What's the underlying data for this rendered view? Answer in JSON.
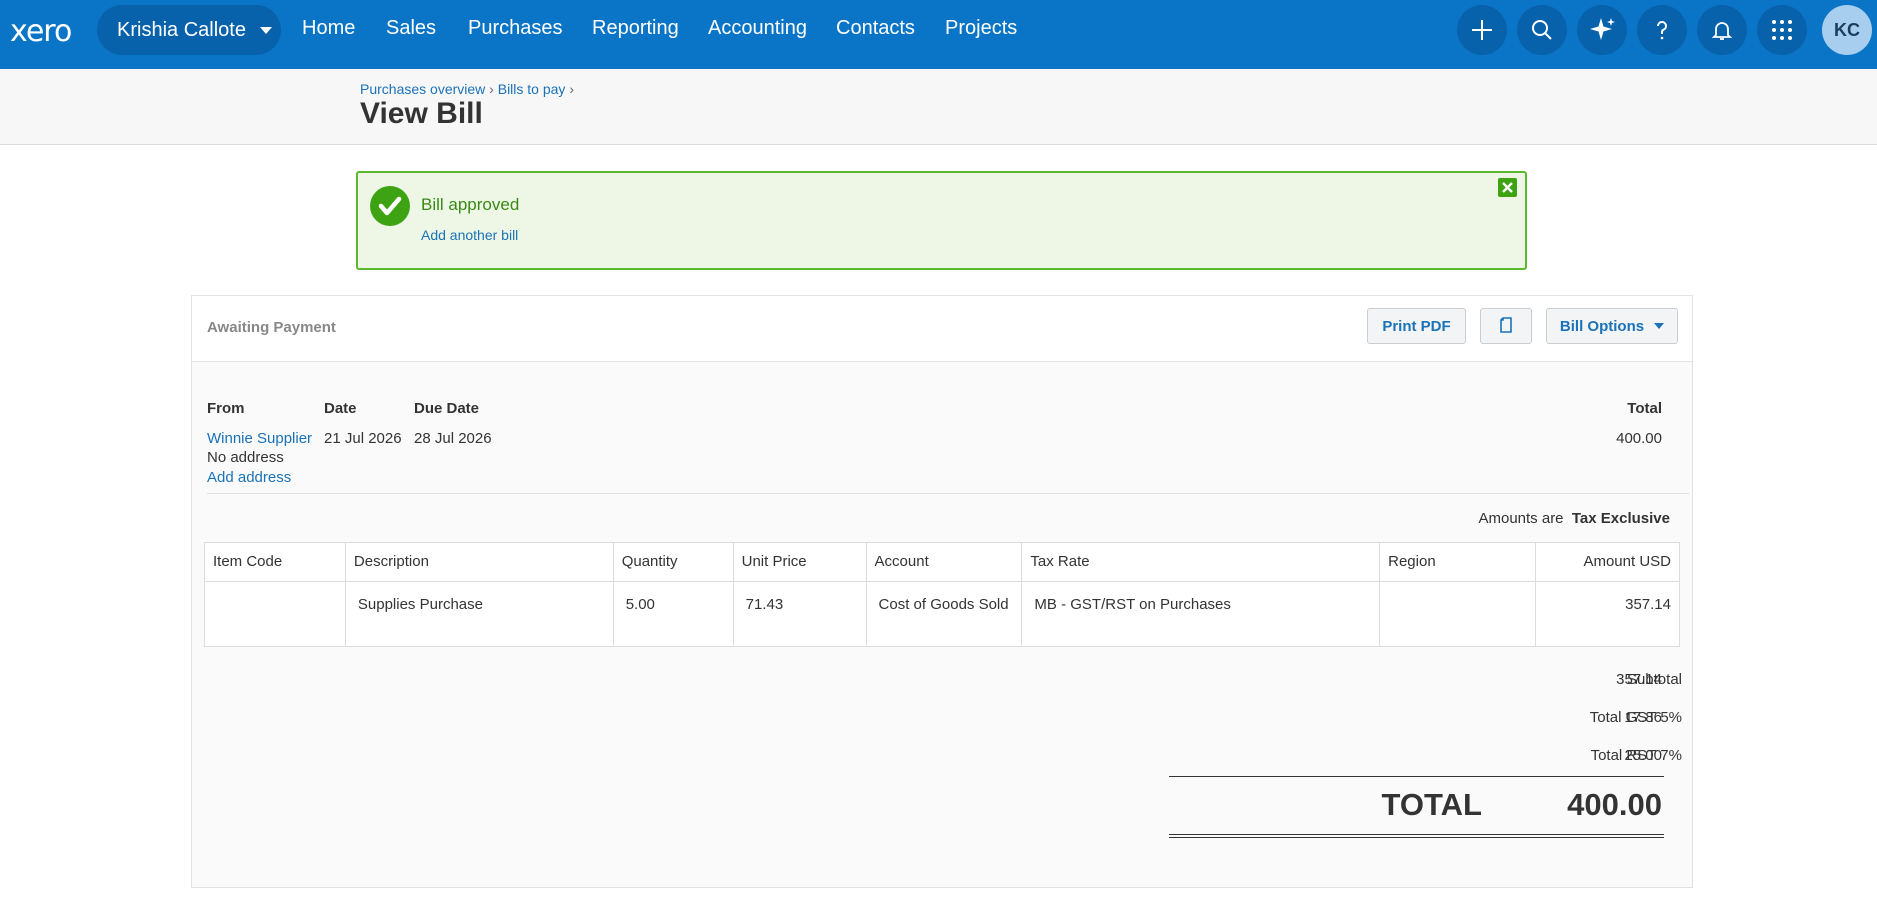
{
  "topnav": {
    "logo": "xero",
    "org_name": "Krishia Callote",
    "items": [
      "Home",
      "Sales",
      "Purchases",
      "Reporting",
      "Accounting",
      "Contacts",
      "Projects"
    ],
    "avatar_initials": "KC"
  },
  "header": {
    "breadcrumbs": [
      "Purchases overview",
      "Bills to pay"
    ],
    "separator": "›",
    "title": "View Bill"
  },
  "banner": {
    "message": "Bill approved",
    "link": "Add another bill"
  },
  "bill": {
    "status": "Awaiting Payment",
    "print_pdf": "Print PDF",
    "options_label": "Bill Options",
    "from_label": "From",
    "date_label": "Date",
    "due_label": "Due Date",
    "total_label": "Total",
    "supplier": "Winnie Supplier",
    "address": "No address",
    "add_address": "Add address",
    "date": "21 Jul 2026",
    "due_date": "28 Jul 2026",
    "total": "400.00",
    "amounts_are": "Amounts are",
    "tax_mode": "Tax Exclusive",
    "columns": [
      "Item Code",
      "Description",
      "Quantity",
      "Unit Price",
      "Account",
      "Tax Rate",
      "Region",
      "Amount USD"
    ],
    "lines": [
      {
        "item_code": "",
        "description": "Supplies Purchase",
        "quantity": "5.00",
        "unit_price": "71.43",
        "account": "Cost of Goods Sold",
        "tax_rate": "MB - GST/RST on Purchases",
        "region": "",
        "amount": "357.14"
      }
    ],
    "subtotal_label": "Subtotal",
    "subtotal": "357.14",
    "gst_label": "Total GST 5%",
    "gst": "17.86",
    "rst_label": "Total RST 7%",
    "rst": "25.00",
    "grand_label": "TOTAL",
    "grand_total": "400.00"
  },
  "colors": {
    "nav_bg": "#0a75c7",
    "link": "#1a72b8",
    "success": "#3ea313"
  }
}
